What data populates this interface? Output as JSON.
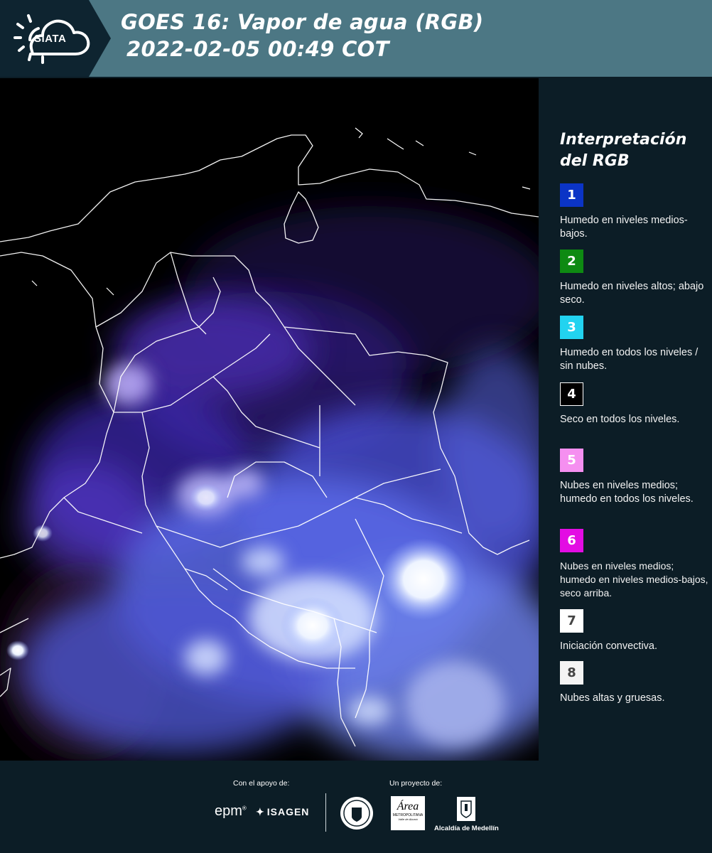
{
  "header": {
    "logo_text": "SIATA",
    "title_line1": "GOES 16: Vapor de agua (RGB)",
    "title_line2": "2022-02-05 00:49 COT",
    "background_color": "#4c7784",
    "logo_tab_color": "#0e2430"
  },
  "legend": {
    "title": "Interpretación del RGB",
    "items": [
      {
        "number": "1",
        "color": "#0b34c6",
        "text_color": "#ffffff",
        "description": "Humedo en niveles medios-bajos."
      },
      {
        "number": "2",
        "color": "#0e8a12",
        "text_color": "#ffffff",
        "description": "Humedo en niveles altos; abajo seco."
      },
      {
        "number": "3",
        "color": "#22d3f0",
        "text_color": "#ffffff",
        "description": "Humedo en todos los niveles / sin nubes."
      },
      {
        "number": "4",
        "color": "#000000",
        "text_color": "#ffffff",
        "description": "Seco en todos los niveles."
      },
      {
        "number": "5",
        "color": "#f58ff0",
        "text_color": "#ffffff",
        "description": "Nubes en niveles medios; humedo en todos los niveles."
      },
      {
        "number": "6",
        "color": "#e30ce3",
        "text_color": "#ffffff",
        "description": "Nubes en niveles medios; humedo en niveles medios-bajos, seco arriba."
      },
      {
        "number": "7",
        "color": "#ffffff",
        "text_color": "#444444",
        "description": "Iniciación convectiva."
      },
      {
        "number": "8",
        "color": "#f4f4f4",
        "text_color": "#444444",
        "description": "Nubes altas y gruesas."
      }
    ]
  },
  "footer": {
    "support_label": "Con el apoyo de:",
    "project_label": "Un proyecto de:",
    "epm_logo": "epm",
    "isagen_logo": "ISAGEN",
    "area_logo": "Área",
    "area_sub": "METROPOLITANA",
    "area_sub2": "Valle de Aburrá",
    "alcaldia_logo": "Alcaldía de Medellín"
  }
}
